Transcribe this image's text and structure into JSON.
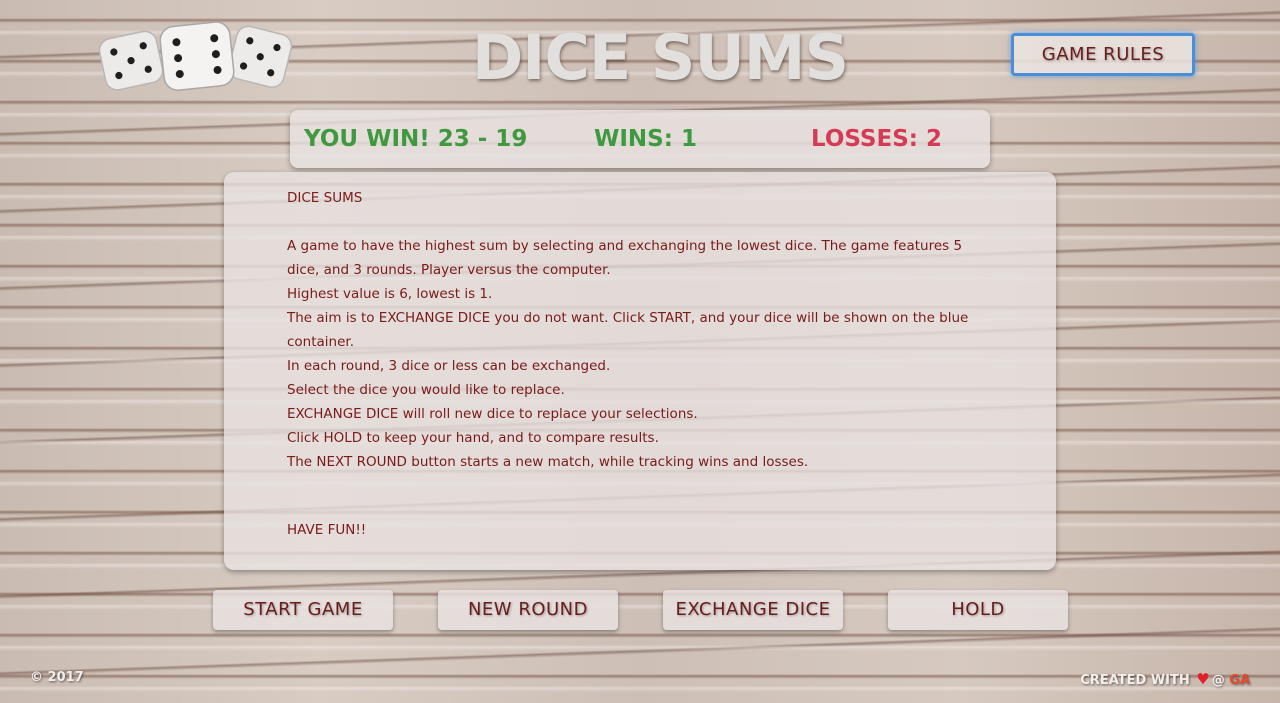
{
  "header": {
    "title": "DICE SUMS",
    "rules_button": "GAME RULES",
    "logo_icon": "dice-icon"
  },
  "scoreboard": {
    "result": "YOU WIN! 23 - 19",
    "wins": "WINS: 1",
    "losses": "LOSSES: 2",
    "colors": {
      "win": "#3f9a3f",
      "loss": "#d63a55"
    }
  },
  "rules": {
    "heading": "DICE SUMS",
    "lines": [
      "A game to have the highest sum by selecting and exchanging the lowest dice. The game features 5 dice, and 3 rounds. Player versus the computer.",
      "Highest value is 6, lowest is 1.",
      "The aim is to EXCHANGE DICE you do not want. Click START, and your dice will be shown on the blue container.",
      "In each round, 3 dice or less can be exchanged.",
      "Select the dice you would like to replace.",
      "EXCHANGE DICE will roll new dice to replace your selections.",
      "Click HOLD to keep your hand, and to compare results.",
      "The NEXT ROUND button starts a new match, while tracking wins and losses."
    ],
    "closing": "HAVE FUN!!"
  },
  "controls": {
    "start": "START GAME",
    "new_round": "NEW ROUND",
    "exchange": "EXCHANGE DICE",
    "hold": "HOLD"
  },
  "footer": {
    "copyright": "© 2017",
    "created_with": "CREATED WITH",
    "at": "@",
    "author": "GA",
    "heart_icon": "heart-icon"
  },
  "colors": {
    "accent_text": "#6b1d1d",
    "rules_button_border": "#4a8fd8"
  }
}
